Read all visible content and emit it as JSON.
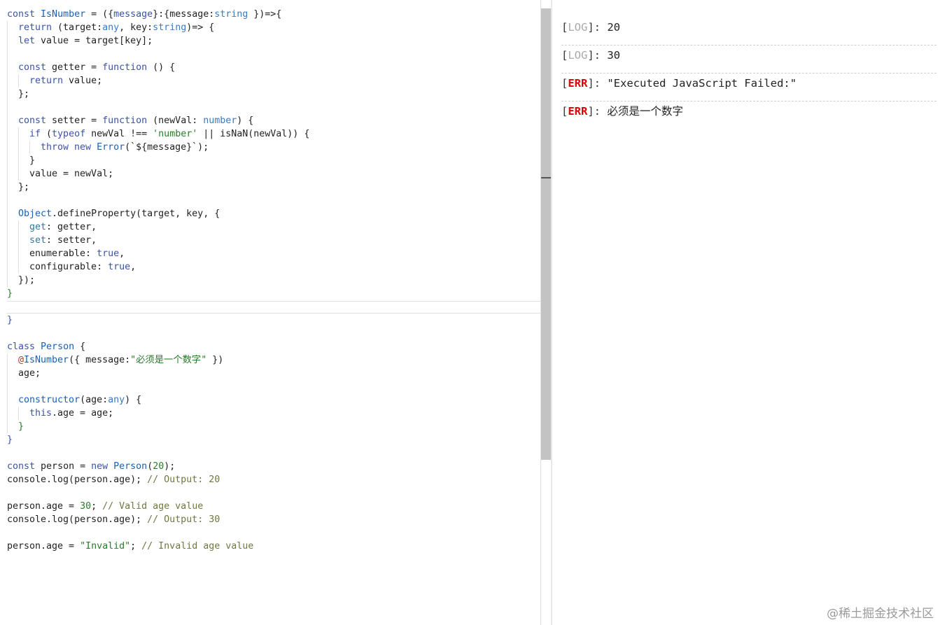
{
  "editor": {
    "lines": [
      [
        {
          "t": "const ",
          "c": "kw"
        },
        {
          "t": "IsNumber",
          "c": "fn"
        },
        {
          "t": " = ({"
        },
        {
          "t": "message",
          "c": "kw"
        },
        {
          "t": "}:{message:"
        },
        {
          "t": "string",
          "c": "ty"
        },
        {
          "t": " })=>{"
        }
      ],
      [
        {
          "i": 1
        },
        {
          "t": "return ",
          "c": "kw"
        },
        {
          "t": "(target:"
        },
        {
          "t": "any",
          "c": "ty"
        },
        {
          "t": ", key:"
        },
        {
          "t": "string",
          "c": "ty"
        },
        {
          "t": ")=> {"
        }
      ],
      [
        {
          "i": 1
        },
        {
          "t": "let ",
          "c": "kw"
        },
        {
          "t": "value = target[key];"
        }
      ],
      [
        {
          "i": 1
        }
      ],
      [
        {
          "i": 1
        },
        {
          "t": "const ",
          "c": "kw"
        },
        {
          "t": "getter = "
        },
        {
          "t": "function",
          "c": "kw"
        },
        {
          "t": " () {"
        }
      ],
      [
        {
          "i": 2
        },
        {
          "t": "return ",
          "c": "kw"
        },
        {
          "t": "value;"
        }
      ],
      [
        {
          "i": 1
        },
        {
          "t": "};"
        }
      ],
      [
        {
          "i": 1
        }
      ],
      [
        {
          "i": 1
        },
        {
          "t": "const ",
          "c": "kw"
        },
        {
          "t": "setter = "
        },
        {
          "t": "function",
          "c": "kw"
        },
        {
          "t": " (newVal: "
        },
        {
          "t": "number",
          "c": "ty"
        },
        {
          "t": ") {"
        }
      ],
      [
        {
          "i": 2
        },
        {
          "t": "if ",
          "c": "kw"
        },
        {
          "t": "("
        },
        {
          "t": "typeof",
          "c": "kw"
        },
        {
          "t": " newVal !== "
        },
        {
          "t": "'number'",
          "c": "st"
        },
        {
          "t": " || isNaN(newVal)) {"
        }
      ],
      [
        {
          "i": 3
        },
        {
          "t": "throw new ",
          "c": "kw"
        },
        {
          "t": "Error",
          "c": "fn"
        },
        {
          "t": "(`${message}`);"
        }
      ],
      [
        {
          "i": 2
        },
        {
          "t": "}"
        }
      ],
      [
        {
          "i": 2
        },
        {
          "t": "value = newVal;"
        }
      ],
      [
        {
          "i": 1
        },
        {
          "t": "};"
        }
      ],
      [
        {
          "i": 1
        }
      ],
      [
        {
          "i": 1
        },
        {
          "t": "Object",
          "c": "fn"
        },
        {
          "t": ".defineProperty(target, key, {"
        }
      ],
      [
        {
          "i": 2
        },
        {
          "t": "get",
          "c": "pp"
        },
        {
          "t": ": getter,"
        }
      ],
      [
        {
          "i": 2
        },
        {
          "t": "set",
          "c": "pp"
        },
        {
          "t": ": setter,"
        }
      ],
      [
        {
          "i": 2
        },
        {
          "t": "enumerable: "
        },
        {
          "t": "true",
          "c": "kw"
        },
        {
          "t": ","
        }
      ],
      [
        {
          "i": 2
        },
        {
          "t": "configurable: "
        },
        {
          "t": "true",
          "c": "kw"
        },
        {
          "t": ","
        }
      ],
      [
        {
          "i": 1
        },
        {
          "t": "});"
        }
      ],
      [
        {
          "t": "}",
          "c": "nm"
        }
      ],
      [],
      [
        {
          "t": "}",
          "c": "kw"
        }
      ],
      [],
      [
        {
          "t": "class ",
          "c": "kw"
        },
        {
          "t": "Person",
          "c": "fn"
        },
        {
          "t": " {"
        }
      ],
      [
        {
          "i": 1
        },
        {
          "t": "@",
          "c": "de"
        },
        {
          "t": "IsNumber",
          "c": "fn"
        },
        {
          "t": "({ message:"
        },
        {
          "t": "\"必须是一个数字\"",
          "c": "st"
        },
        {
          "t": " })"
        }
      ],
      [
        {
          "i": 1
        },
        {
          "t": "age;"
        }
      ],
      [
        {
          "i": 1
        }
      ],
      [
        {
          "i": 1
        },
        {
          "t": "constructor",
          "c": "fn"
        },
        {
          "t": "(age:"
        },
        {
          "t": "any",
          "c": "ty"
        },
        {
          "t": ") {"
        }
      ],
      [
        {
          "i": 2
        },
        {
          "t": "this",
          "c": "kw"
        },
        {
          "t": ".age = age;"
        }
      ],
      [
        {
          "i": 1
        },
        {
          "t": "}",
          "c": "nm"
        }
      ],
      [
        {
          "t": "}",
          "c": "kw"
        }
      ],
      [],
      [
        {
          "t": "const ",
          "c": "kw"
        },
        {
          "t": "person = "
        },
        {
          "t": "new ",
          "c": "kw"
        },
        {
          "t": "Person",
          "c": "fn"
        },
        {
          "t": "("
        },
        {
          "t": "20",
          "c": "nm"
        },
        {
          "t": ");"
        }
      ],
      [
        {
          "t": "console.log(person.age); "
        },
        {
          "t": "// Output: 20",
          "c": "cm"
        }
      ],
      [],
      [
        {
          "t": "person.age = "
        },
        {
          "t": "30",
          "c": "nm"
        },
        {
          "t": "; "
        },
        {
          "t": "// Valid age value",
          "c": "cm"
        }
      ],
      [
        {
          "t": "console.log(person.age); "
        },
        {
          "t": "// Output: 30",
          "c": "cm"
        }
      ],
      [],
      [
        {
          "t": "person.age = "
        },
        {
          "t": "\"Invalid\"",
          "c": "st"
        },
        {
          "t": "; "
        },
        {
          "t": "// Invalid age value",
          "c": "cm"
        }
      ]
    ]
  },
  "console": {
    "entries": [
      {
        "tag": "LOG",
        "type": "log",
        "message": "20"
      },
      {
        "tag": "LOG",
        "type": "log",
        "message": "30"
      },
      {
        "tag": "ERR",
        "type": "err",
        "message": "\"Executed JavaScript Failed:\""
      },
      {
        "tag": "ERR",
        "type": "err",
        "message": "必须是一个数字"
      }
    ]
  },
  "watermark": "@稀土掘金技术社区"
}
